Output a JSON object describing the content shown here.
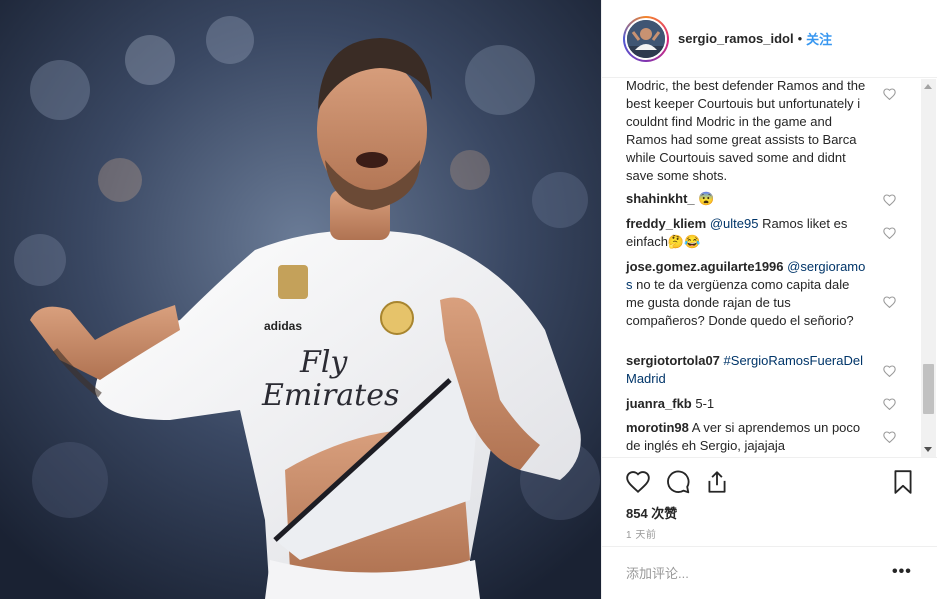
{
  "post": {
    "username": "sergio_ramos_idol",
    "follow_label": "关注",
    "separator": "•"
  },
  "comments": [
    {
      "text": "Modric, the best defender Ramos and the best keeper Courtouis but unfortunately i couldnt find Modric in the game and Ramos had some great assists to Barca while Courtouis saved some and didnt save some shots."
    },
    {
      "user": "shahinkht_",
      "text": "😨"
    },
    {
      "user": "freddy_kliem",
      "tag": "@ulte95",
      "text": " Ramos liket es einfach🤔😂"
    },
    {
      "user": "jose.gomez.aguilarte1996",
      "tag": "@sergioramos",
      "text": " no te da vergüenza como capita dale me gusta donde rajan de tus compañeros? Donde quedo el señorio?"
    },
    {
      "user": "sergiotortola07",
      "tag": "#SergioRamosFueraDelMadrid",
      "text": ""
    },
    {
      "user": "juanra_fkb",
      "text": "5-1"
    },
    {
      "user": "morotin98",
      "text": "A ver si aprendemos un poco de inglés eh Sergio, jajajaja"
    }
  ],
  "actions": {
    "likes": "854 次赞",
    "time": "1 天前"
  },
  "add_comment": {
    "placeholder": "添加评论...",
    "more_label": "•••"
  },
  "icons": [
    "heart-icon",
    "comment-icon",
    "share-icon",
    "bookmark-icon",
    "more-icon"
  ],
  "colors": {
    "link": "#3897f0",
    "tag": "#003569",
    "text": "#262626",
    "muted": "#999999"
  }
}
